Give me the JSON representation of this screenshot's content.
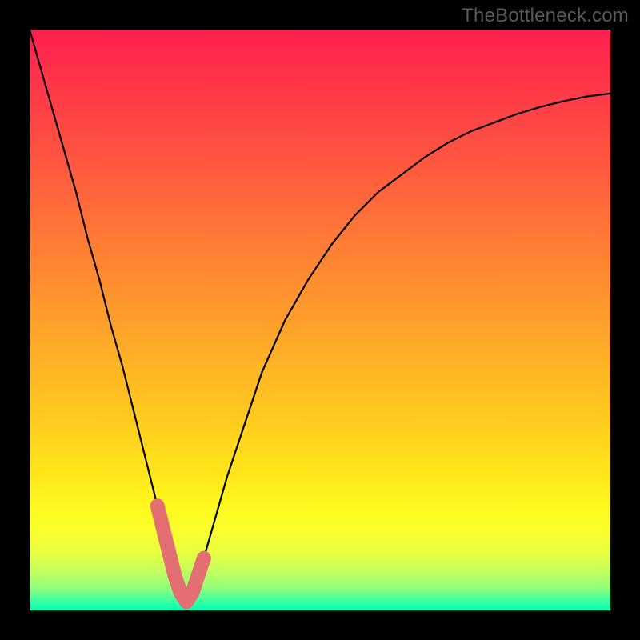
{
  "watermark": "TheBottleneck.com",
  "colors": {
    "frame": "#000000",
    "curve_stroke": "#000000",
    "highlight_stroke": "#e36f72",
    "gradient_top": "#ff1f4e",
    "gradient_bottom": "#00ffb6"
  },
  "chart_data": {
    "type": "line",
    "title": "",
    "xlabel": "",
    "ylabel": "",
    "xlim": [
      0,
      100
    ],
    "ylim": [
      0,
      100
    ],
    "grid": false,
    "legend": false,
    "note": "Axes are unlabeled in the source image; x/y values are estimated as percentages of the plot area (0–100). y increases upward.",
    "series": [
      {
        "name": "main-curve",
        "x": [
          0,
          2,
          4,
          6,
          8,
          10,
          12,
          14,
          16,
          18,
          20,
          22,
          23.5,
          25,
          26,
          27,
          28,
          30,
          32,
          34,
          36,
          38,
          40,
          44,
          48,
          52,
          56,
          60,
          64,
          68,
          72,
          76,
          80,
          84,
          88,
          92,
          96,
          100
        ],
        "y": [
          100,
          93,
          86,
          79,
          72,
          64,
          57,
          49,
          42,
          34,
          26,
          18,
          12,
          6,
          3,
          1.5,
          3,
          9,
          16,
          23,
          29,
          35,
          41,
          50,
          57,
          63,
          68,
          72,
          75,
          78,
          80.5,
          82.5,
          84,
          85.5,
          86.7,
          87.7,
          88.5,
          89
        ]
      },
      {
        "name": "highlighted-minimum",
        "x": [
          22,
          23.5,
          25,
          26,
          27,
          28,
          30
        ],
        "y": [
          18,
          12,
          6,
          3,
          1.5,
          3,
          9
        ]
      }
    ]
  }
}
